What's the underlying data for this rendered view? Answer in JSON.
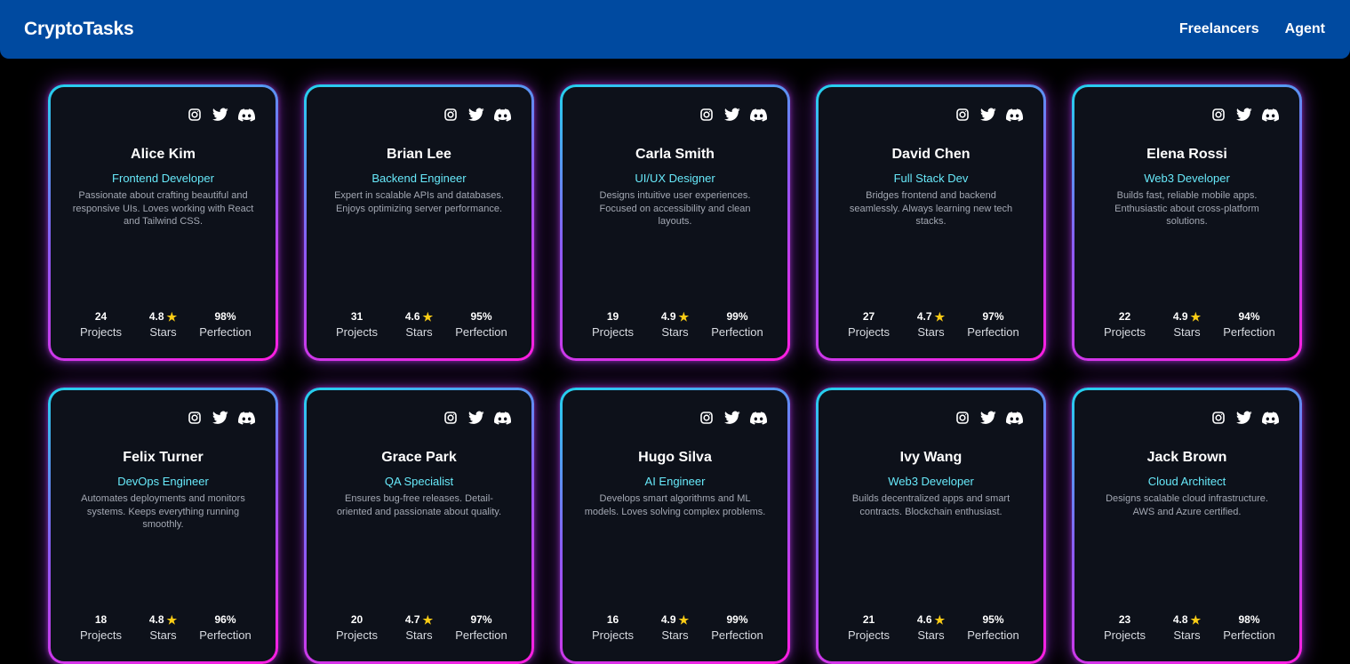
{
  "nav": {
    "brand": "CryptoTasks",
    "links": [
      "Freelancers",
      "Agent"
    ]
  },
  "stat_labels": {
    "projects": "Projects",
    "stars": "Stars",
    "perfection": "Perfection"
  },
  "icons": [
    "instagram-icon",
    "twitter-icon",
    "discord-icon",
    "star-icon"
  ],
  "colors": {
    "navbar": "#004aa0",
    "card_bg": "#0d111a",
    "role": "#67e8f9",
    "star": "#facc15"
  },
  "freelancers": [
    {
      "name": "Alice Kim",
      "role": "Frontend Developer",
      "bio": "Passionate about crafting beautiful and responsive UIs. Loves working with React and Tailwind CSS.",
      "projects": "24",
      "stars": "4.8",
      "perfection": "98%"
    },
    {
      "name": "Brian Lee",
      "role": "Backend Engineer",
      "bio": "Expert in scalable APIs and databases. Enjoys optimizing server performance.",
      "projects": "31",
      "stars": "4.6",
      "perfection": "95%"
    },
    {
      "name": "Carla Smith",
      "role": "UI/UX Designer",
      "bio": "Designs intuitive user experiences. Focused on accessibility and clean layouts.",
      "projects": "19",
      "stars": "4.9",
      "perfection": "99%"
    },
    {
      "name": "David Chen",
      "role": "Full Stack Dev",
      "bio": "Bridges frontend and backend seamlessly. Always learning new tech stacks.",
      "projects": "27",
      "stars": "4.7",
      "perfection": "97%"
    },
    {
      "name": "Elena Rossi",
      "role": "Web3 Developer",
      "bio": "Builds fast, reliable mobile apps. Enthusiastic about cross-platform solutions.",
      "projects": "22",
      "stars": "4.9",
      "perfection": "94%"
    },
    {
      "name": "Felix Turner",
      "role": "DevOps Engineer",
      "bio": "Automates deployments and monitors systems. Keeps everything running smoothly.",
      "projects": "18",
      "stars": "4.8",
      "perfection": "96%"
    },
    {
      "name": "Grace Park",
      "role": "QA Specialist",
      "bio": "Ensures bug-free releases. Detail-oriented and passionate about quality.",
      "projects": "20",
      "stars": "4.7",
      "perfection": "97%"
    },
    {
      "name": "Hugo Silva",
      "role": "AI Engineer",
      "bio": "Develops smart algorithms and ML models. Loves solving complex problems.",
      "projects": "16",
      "stars": "4.9",
      "perfection": "99%"
    },
    {
      "name": "Ivy Wang",
      "role": "Web3 Developer",
      "bio": "Builds decentralized apps and smart contracts. Blockchain enthusiast.",
      "projects": "21",
      "stars": "4.6",
      "perfection": "95%"
    },
    {
      "name": "Jack Brown",
      "role": "Cloud Architect",
      "bio": "Designs scalable cloud infrastructure. AWS and Azure certified.",
      "projects": "23",
      "stars": "4.8",
      "perfection": "98%"
    }
  ]
}
